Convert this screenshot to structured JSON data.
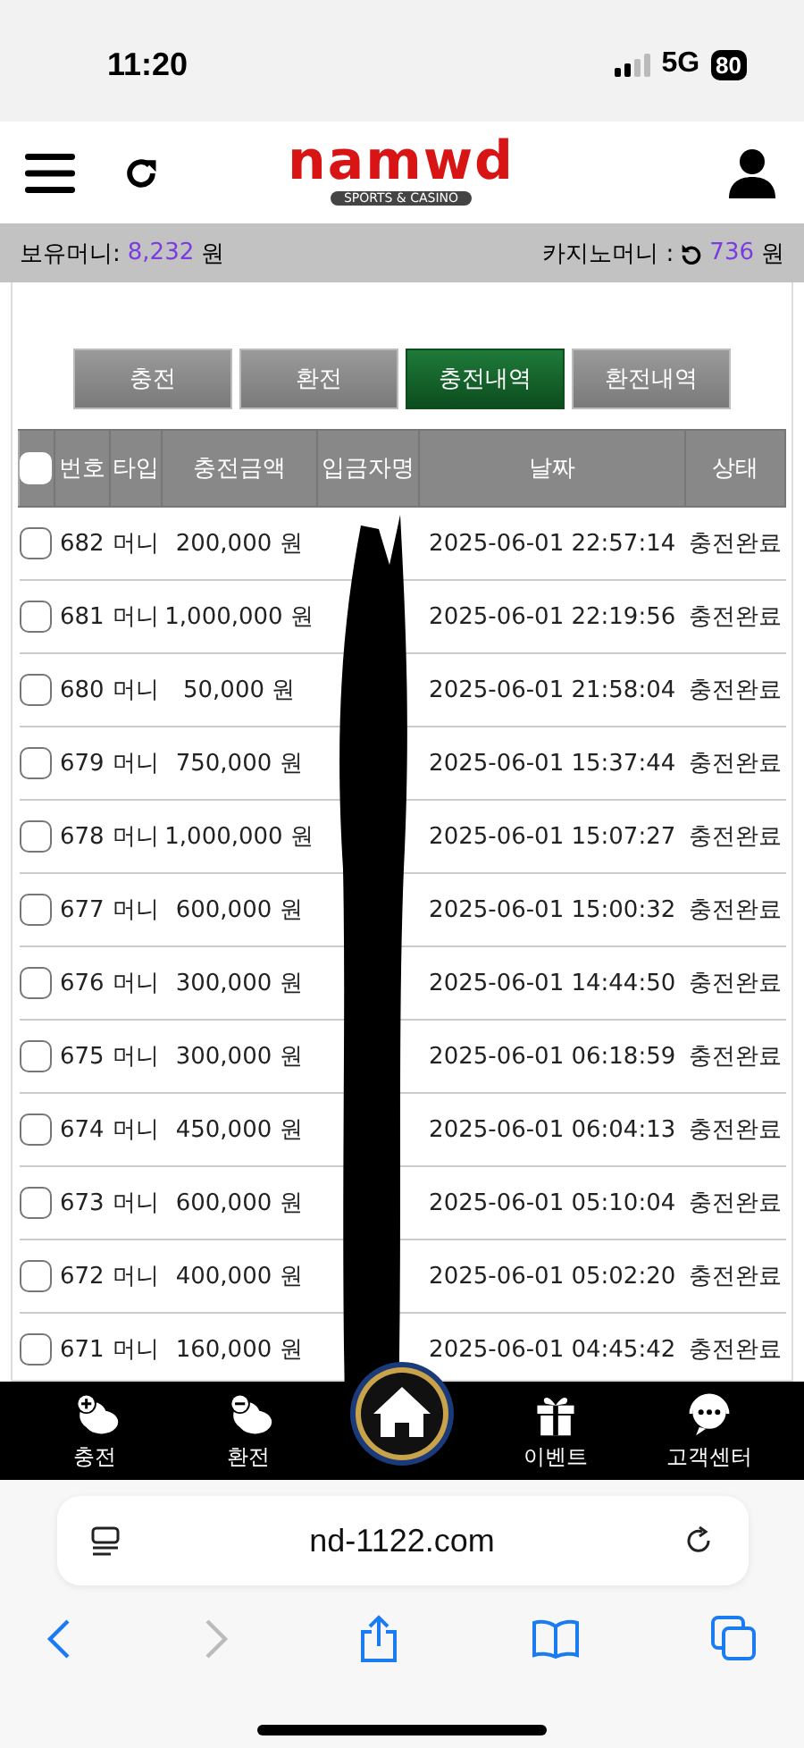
{
  "status_bar": {
    "time": "11:20",
    "network": "5G",
    "battery": "80"
  },
  "header": {
    "logo": "namwd",
    "logo_sub": "SPORTS & CASINO"
  },
  "balance": {
    "label": "보유머니:",
    "amount": "8,232",
    "unit": "원",
    "casino_label": "카지노머니 :",
    "casino_amount": "736",
    "casino_unit": "원"
  },
  "tabs": [
    {
      "label": "충전",
      "selected": false
    },
    {
      "label": "환전",
      "selected": false
    },
    {
      "label": "충전내역",
      "selected": true
    },
    {
      "label": "환전내역",
      "selected": false
    }
  ],
  "table": {
    "select_all_checked": false,
    "columns": [
      "번호",
      "타입",
      "충전금액",
      "입금자명",
      "날짜",
      "상태"
    ],
    "rows": [
      {
        "checked": false,
        "cells": [
          "682",
          "머니",
          "200,000 원",
          "",
          "2025-06-01 22:57:14",
          "충전완료"
        ]
      },
      {
        "checked": false,
        "cells": [
          "681",
          "머니",
          "1,000,000 원",
          "",
          "2025-06-01 22:19:56",
          "충전완료"
        ]
      },
      {
        "checked": false,
        "cells": [
          "680",
          "머니",
          "50,000 원",
          "",
          "2025-06-01 21:58:04",
          "충전완료"
        ]
      },
      {
        "checked": false,
        "cells": [
          "679",
          "머니",
          "750,000 원",
          "",
          "2025-06-01 15:37:44",
          "충전완료"
        ]
      },
      {
        "checked": false,
        "cells": [
          "678",
          "머니",
          "1,000,000 원",
          "",
          "2025-06-01 15:07:27",
          "충전완료"
        ]
      },
      {
        "checked": false,
        "cells": [
          "677",
          "머니",
          "600,000 원",
          "",
          "2025-06-01 15:00:32",
          "충전완료"
        ]
      },
      {
        "checked": false,
        "cells": [
          "676",
          "머니",
          "300,000 원",
          "",
          "2025-06-01 14:44:50",
          "충전완료"
        ]
      },
      {
        "checked": false,
        "cells": [
          "675",
          "머니",
          "300,000 원",
          "",
          "2025-06-01 06:18:59",
          "충전완료"
        ]
      },
      {
        "checked": false,
        "cells": [
          "674",
          "머니",
          "450,000 원",
          "",
          "2025-06-01 06:04:13",
          "충전완료"
        ]
      },
      {
        "checked": false,
        "cells": [
          "673",
          "머니",
          "600,000 원",
          "",
          "2025-06-01 05:10:04",
          "충전완료"
        ]
      },
      {
        "checked": false,
        "cells": [
          "672",
          "머니",
          "400,000 원",
          "",
          "2025-06-01 05:02:20",
          "충전완료"
        ]
      },
      {
        "checked": false,
        "cells": [
          "671",
          "머니",
          "160,000 원",
          "",
          "2025-06-01 04:45:42",
          "충전완료"
        ]
      }
    ]
  },
  "bottom_nav": [
    {
      "kind": "item",
      "label": "충전"
    },
    {
      "kind": "item",
      "label": "환전"
    },
    {
      "kind": "home"
    },
    {
      "kind": "item",
      "label": "이벤트"
    },
    {
      "kind": "item",
      "label": "고객센터"
    }
  ],
  "browser": {
    "url": "nd-1122.com",
    "forward_disabled": true
  }
}
